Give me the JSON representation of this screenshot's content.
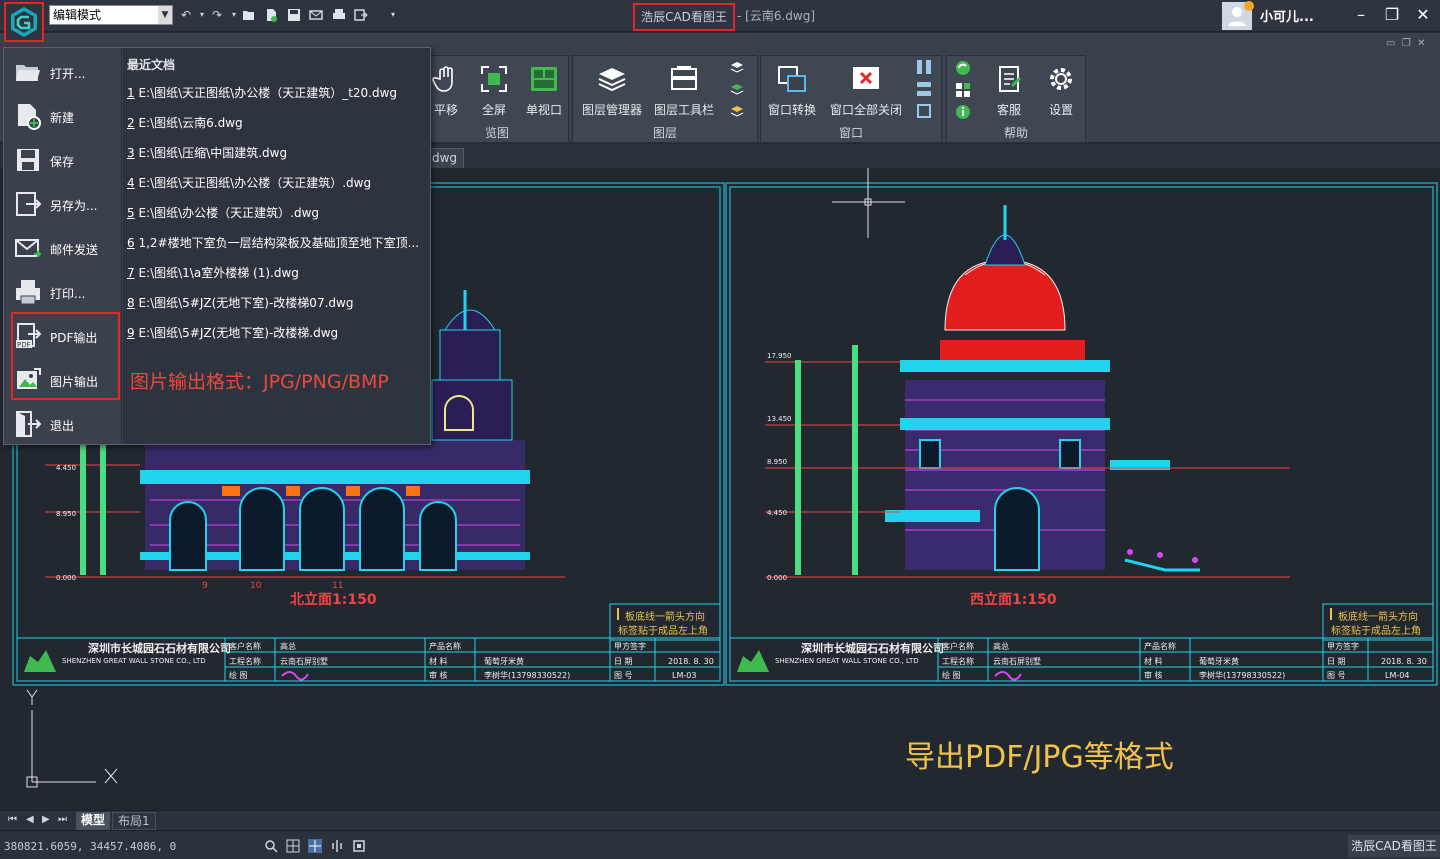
{
  "titlebar": {
    "mode": "编辑模式",
    "app_title": "浩辰CAD看图王",
    "doc_title": " - [云南6.dwg]",
    "username": "小可儿..."
  },
  "ribbon": {
    "groups": [
      {
        "label": "览图",
        "buttons": [
          "平移",
          "全屏",
          "单视口"
        ]
      },
      {
        "label": "图层",
        "buttons": [
          "图层管理器",
          "图层工具栏"
        ]
      },
      {
        "label": "窗口",
        "buttons": [
          "窗口转换",
          "窗口全部关闭"
        ]
      },
      {
        "label": "帮助",
        "buttons": [
          "客服",
          "设置"
        ]
      }
    ]
  },
  "tab": {
    "file": "dwg"
  },
  "app_menu": {
    "items": [
      {
        "label": "打开...",
        "icon": "folder-open-icon"
      },
      {
        "label": "新建",
        "icon": "new-file-icon"
      },
      {
        "label": "保存",
        "icon": "save-icon"
      },
      {
        "label": "另存为...",
        "icon": "save-as-icon"
      },
      {
        "label": "邮件发送",
        "icon": "mail-icon"
      },
      {
        "label": "打印...",
        "icon": "printer-icon"
      },
      {
        "label": "PDF输出",
        "icon": "pdf-export-icon"
      },
      {
        "label": "图片输出",
        "icon": "image-export-icon"
      },
      {
        "label": "退出",
        "icon": "exit-icon"
      }
    ],
    "recent_title": "最近文档",
    "recent": [
      {
        "num": "1",
        "path": " E:\\图纸\\天正图纸\\办公楼（天正建筑）_t20.dwg"
      },
      {
        "num": "2",
        "path": " E:\\图纸\\云南6.dwg"
      },
      {
        "num": "3",
        "path": " E:\\图纸\\压缩\\中国建筑.dwg"
      },
      {
        "num": "4",
        "path": " E:\\图纸\\天正图纸\\办公楼（天正建筑）.dwg"
      },
      {
        "num": "5",
        "path": " E:\\图纸\\办公楼（天正建筑）.dwg"
      },
      {
        "num": "6",
        "path": " 1,2#楼地下室负一层结构梁板及基础顶至地下室顶..."
      },
      {
        "num": "7",
        "path": " E:\\图纸\\1\\a室外楼梯 (1).dwg"
      },
      {
        "num": "8",
        "path": " E:\\图纸\\5#JZ(无地下室)-改楼梯07.dwg"
      },
      {
        "num": "9",
        "path": " E:\\图纸\\5#JZ(无地下室)-改楼梯.dwg"
      }
    ],
    "format_note": "图片输出格式：JPG/PNG/BMP"
  },
  "drawing": {
    "left_title": "北立面1:150",
    "right_title": "西立面1:150",
    "note_line1": "板底线一箭头方向",
    "note_line2": "标签贴于成品左上角",
    "company_cn": "深圳市长城园石石材有限公司",
    "company_en": "SHENZHEN GREAT WALL STONE CO., LTD",
    "client_label": "客户名称",
    "client": "高总",
    "project_label": "工程名称",
    "project": "云南石屏别墅",
    "drawer_label": "绘    图",
    "product_label": "产品名称",
    "material_label": "材    料",
    "material": "葡萄牙米黄",
    "reviewer_label": "审    核",
    "reviewer": "李树华(13798330522)",
    "sign_label": "甲方签字",
    "date_label": "日    期",
    "date": "2018. 8. 30",
    "sheet_label": "图    号",
    "sheet_left": "LM-03",
    "sheet_right": "LM-04",
    "elev_labels": [
      "17.950",
      "13.450",
      "8.950",
      "4.450",
      "0.000"
    ],
    "axis_labels": [
      "9",
      "10",
      "11"
    ]
  },
  "export_note": "导出PDF/JPG等格式",
  "layout_tabs": [
    "模型",
    "布局1"
  ],
  "status": {
    "coords": "380821.6059, 34457.4086, 0",
    "brand": "浩辰CAD看图王"
  },
  "colors": {
    "accent_red": "#e02828",
    "cad_cyan": "#22d3ee",
    "cad_magenta": "#d946ef",
    "note_yellow": "#f0c24a"
  }
}
